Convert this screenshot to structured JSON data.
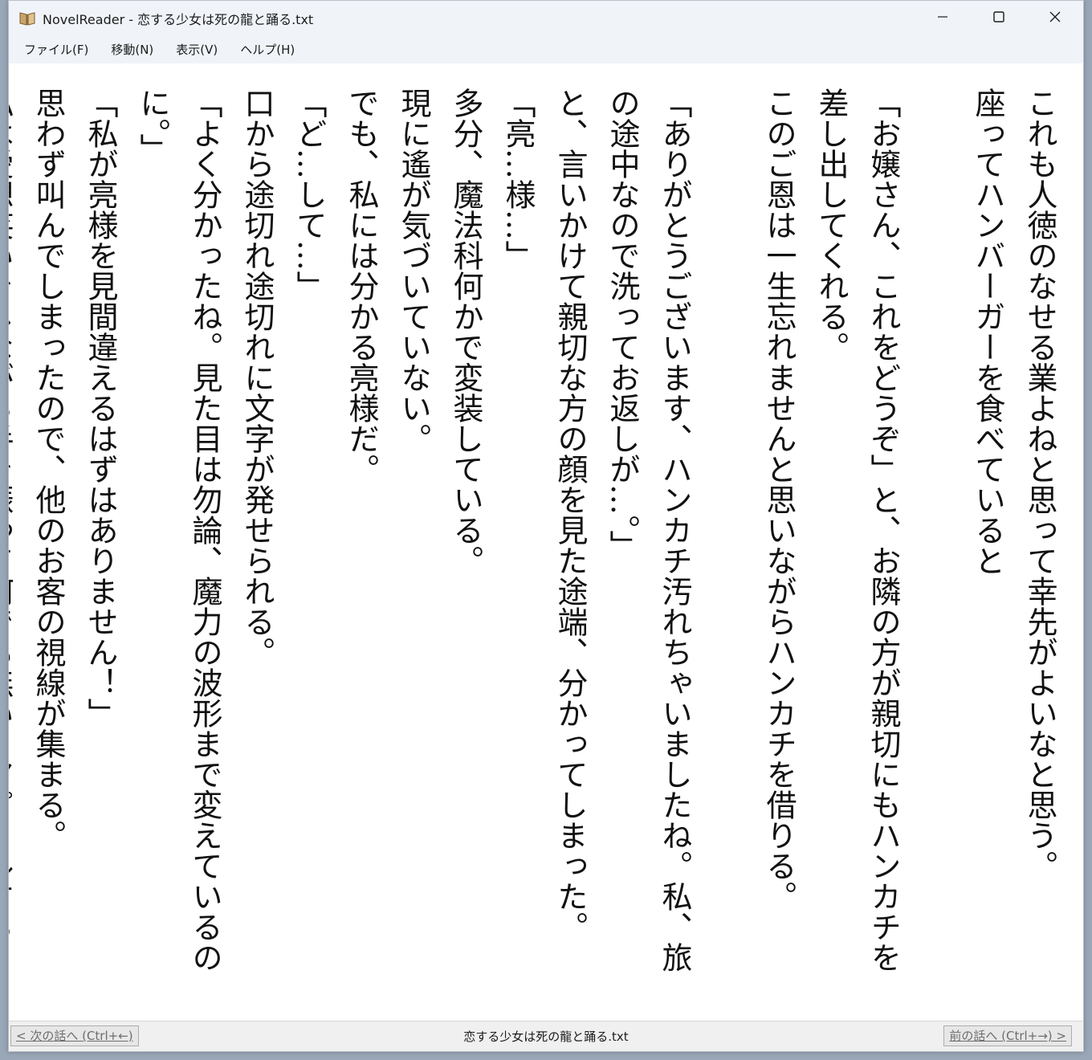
{
  "window": {
    "app_icon": "book-icon",
    "title": "NovelReader - 恋する少女は死の龍と踊る.txt",
    "controls": {
      "minimize": "minimize-icon",
      "maximize": "maximize-icon",
      "close": "close-icon"
    }
  },
  "menu": {
    "items": [
      {
        "label": "ファイル(F)"
      },
      {
        "label": "移動(N)"
      },
      {
        "label": "表示(V)"
      },
      {
        "label": "ヘルプ(H)"
      }
    ]
  },
  "novel": {
    "lines": [
      "これも人徳のなせる業よねと思って幸先がよいなと思う。",
      "座ってハンバーガーを食べていると",
      "",
      "「お嬢さん、これをどうぞ」と、お隣の方が親切にもハンカチを",
      "差し出してくれる。",
      "このご恩は一生忘れませんと思いながらハンカチを借りる。",
      "",
      "「ありがとうございます、ハンカチ汚れちゃいましたね。私、旅",
      "の途中なので洗ってお返しが…。」",
      "と、言いかけて親切な方の顔を見た途端、分かってしまった。",
      "「亮…様…」",
      "多分、魔法科何かで変装している。",
      "現に遙が気づいていない。",
      "でも、私には分かる亮様だ。",
      "「ど…して…」",
      "口から途切れ途切れに文字が発せられる。",
      "「よく分かったね。見た目は勿論、魔力の波形まで変えているの",
      "に。」",
      "「私が亮様を見間違えるはずはありません！」",
      "思わず叫んでしまったので、他のお客の視線が集まる。",
      "私は愛想笑いをしながら手を振って何でも無いとアピールする"
    ]
  },
  "status": {
    "prev_episode": "< 次の話へ (Ctrl+←)",
    "file_name": "恋する少女は死の龍と踊る.txt",
    "next_episode": "前の話へ (Ctrl+→) >"
  }
}
